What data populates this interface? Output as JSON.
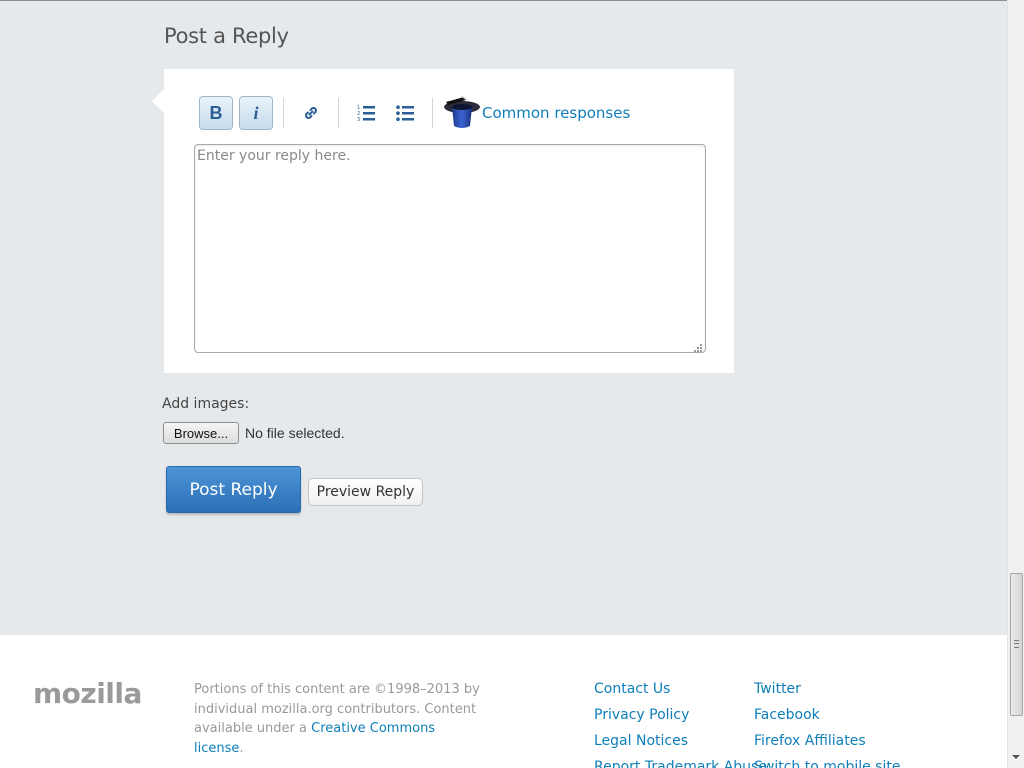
{
  "reply_section": {
    "title": "Post a Reply",
    "toolbar": {
      "bold_label": "B",
      "italic_label": "i",
      "link_icon": "link-icon",
      "numbered_list_icon": "numbered-list-icon",
      "bulleted_list_icon": "bulleted-list-icon",
      "common_responses_icon": "magic-hat-icon",
      "common_responses_label": "Common responses"
    },
    "textarea_placeholder": "Enter your reply here.",
    "textarea_value": "",
    "add_images_label": "Add images:",
    "browse_label": "Browse...",
    "file_status": "No file selected.",
    "post_button": "Post Reply",
    "preview_button": "Preview Reply"
  },
  "footer": {
    "logo": "mozilla",
    "legal_text_1": "Portions of this content are ©1998–2013 by individual mozilla.org contributors. Content available under a",
    "license_link": "Creative Commons license",
    "legal_text_2": ".",
    "links_col1": [
      "Contact Us",
      "Privacy Policy",
      "Legal Notices",
      "Report Trademark Abuse"
    ],
    "links_col2": [
      "Twitter",
      "Facebook",
      "Firefox Affiliates",
      "Switch to mobile site"
    ]
  },
  "colors": {
    "background": "#e6e9ec",
    "link": "#0f7fba",
    "primary_button": "#3a80c6",
    "toolbar_icon": "#2b5f96"
  }
}
